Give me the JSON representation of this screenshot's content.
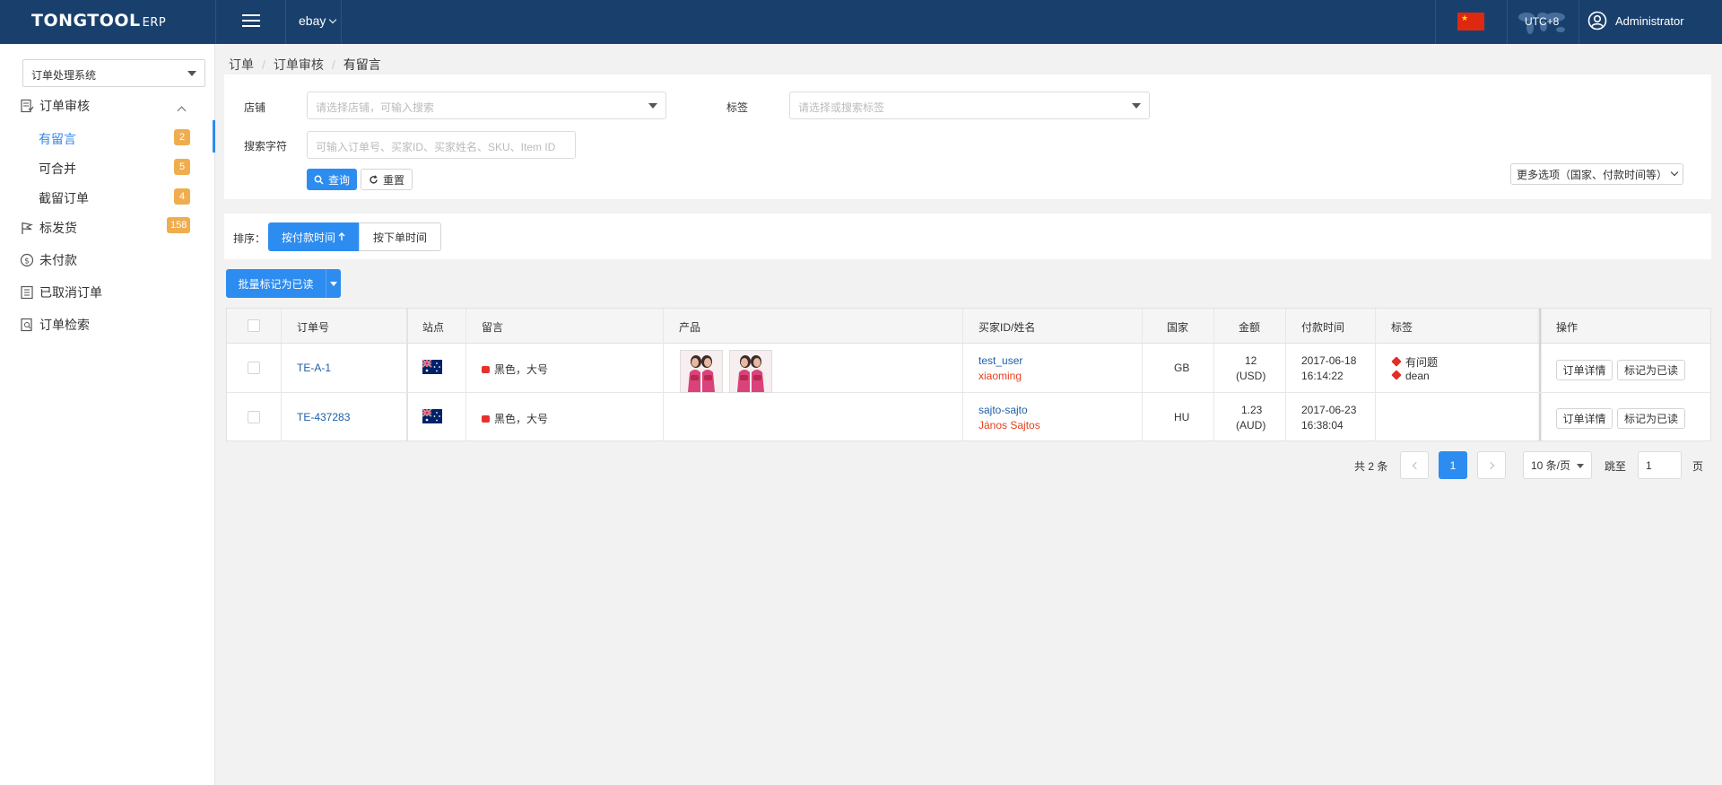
{
  "topbar": {
    "logo_main": "TONGTOOL",
    "logo_sub": "ERP",
    "platform": "ebay",
    "timezone": "UTC+8",
    "user": "Administrator",
    "language_flag": "china-flag"
  },
  "sidebar": {
    "system_select": "订单处理系统",
    "sections": [
      {
        "label": "订单审核",
        "icon": "review-icon",
        "expanded": true
      },
      {
        "label": "标发货",
        "icon": "flag-icon",
        "badge": "158"
      },
      {
        "label": "未付款",
        "icon": "dollar-icon"
      },
      {
        "label": "已取消订单",
        "icon": "list-icon"
      },
      {
        "label": "订单检索",
        "icon": "search-doc-icon"
      }
    ],
    "sub_items": [
      {
        "label": "有留言",
        "badge": "2",
        "active": true
      },
      {
        "label": "可合并",
        "badge": "5"
      },
      {
        "label": "截留订单",
        "badge": "4"
      }
    ]
  },
  "breadcrumb": [
    "订单",
    "订单审核",
    "有留言"
  ],
  "filter": {
    "shop_label": "店铺",
    "shop_placeholder": "请选择店铺，可输入搜索",
    "tag_label": "标签",
    "tag_placeholder": "请选择或搜索标签",
    "search_label": "搜索字符",
    "search_placeholder": "可输入订单号、买家ID、买家姓名、SKU、Item ID",
    "query_button": "查询",
    "reset_button": "重置",
    "more_options": "更多选项（国家、付款时间等）"
  },
  "sort": {
    "label": "排序：",
    "by_payment": "按付款时间",
    "by_order": "按下单时间"
  },
  "bulk_button": "批量标记为已读",
  "table": {
    "headers": [
      "订单号",
      "站点",
      "留言",
      "产品",
      "买家ID/姓名",
      "国家",
      "金额",
      "付款时间",
      "标签",
      "操作"
    ],
    "rows": [
      {
        "order_no": "TE-A-1",
        "site": "australia-flag",
        "message": "黑色，大号",
        "products": 2,
        "buyer_id": "test_user",
        "buyer_name": "xiaoming",
        "country": "GB",
        "amount": "12",
        "currency": "(USD)",
        "pay_date": "2017-06-18",
        "pay_time": "16:14:22",
        "tags": [
          "有问题",
          "dean"
        ],
        "action_detail": "订单详情",
        "action_read": "标记为已读"
      },
      {
        "order_no": "TE-437283",
        "site": "australia-flag",
        "message": "黑色，大号",
        "products": 0,
        "buyer_id": "sajto-sajto",
        "buyer_name": "János Sajtos",
        "country": "HU",
        "amount": "1.23",
        "currency": "(AUD)",
        "pay_date": "2017-06-23",
        "pay_time": "16:38:04",
        "tags": [],
        "action_detail": "订单详情",
        "action_read": "标记为已读"
      }
    ]
  },
  "pagination": {
    "total": "共 2 条",
    "current_page": "1",
    "page_size": "10 条/页",
    "goto_label": "跳至",
    "goto_value": "1",
    "page_suffix": "页"
  },
  "colors": {
    "topbar": "#19406d",
    "primary": "#2d8cf0",
    "badge": "#f0ad4e",
    "link": "#1f5fa6",
    "red": "#e8401c"
  }
}
